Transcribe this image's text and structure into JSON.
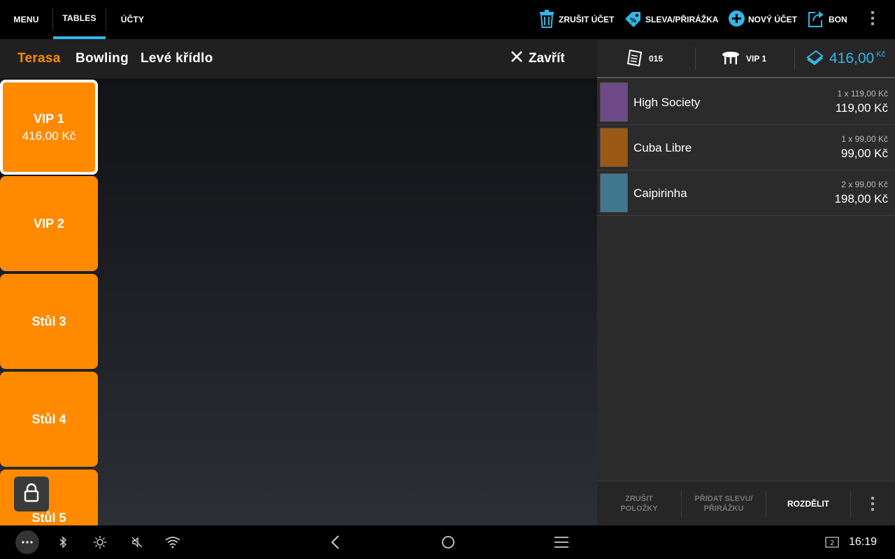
{
  "topbar": {
    "tabs": [
      {
        "label": "MENU"
      },
      {
        "label": "TABLES",
        "active": true
      },
      {
        "label": "ÚČTY"
      }
    ],
    "actions": {
      "cancel_bill": "ZRUŠIT ÚČET",
      "discount": "SLEVA/PŘIRÁŽKA",
      "new_bill": "NOVÝ ÚČET",
      "bon": "BON"
    },
    "accent_color": "#33b5e5"
  },
  "areas": {
    "tabs": [
      {
        "label": "Terasa",
        "active": true
      },
      {
        "label": "Bowling"
      },
      {
        "label": "Levé křídlo"
      }
    ],
    "close_label": "Zavřít",
    "active_color": "#ff8c00"
  },
  "tables": [
    {
      "name": "VIP 1",
      "amount": "416,00 Kč",
      "selected": true
    },
    {
      "name": "VIP 2",
      "amount": ""
    },
    {
      "name": "Stůl 3",
      "amount": ""
    },
    {
      "name": "Stůl 4",
      "amount": ""
    },
    {
      "name": "Stůl 5",
      "amount": ""
    }
  ],
  "order": {
    "receipt_number": "015",
    "table_name": "VIP 1",
    "total": "416,00",
    "currency": "Kč",
    "items": [
      {
        "name": "High Society",
        "qty_line": "1 x 119,00 Kč",
        "price": "119,00 Kč",
        "color": "#6f4a89"
      },
      {
        "name": "Cuba Libre",
        "qty_line": "1 x 99,00 Kč",
        "price": "99,00 Kč",
        "color": "#9a5a14"
      },
      {
        "name": "Caipirinha",
        "qty_line": "2 x 99,00 Kč",
        "price": "198,00 Kč",
        "color": "#41778e"
      }
    ],
    "footer": {
      "cancel_items": "ZRUŠIT POLOŽKY",
      "add_discount": "PŘIDAT SLEVU/ PŘIRÁŽKU",
      "split": "ROZDĚLIT"
    }
  },
  "system": {
    "notification_count": "2",
    "time": "16:19"
  }
}
